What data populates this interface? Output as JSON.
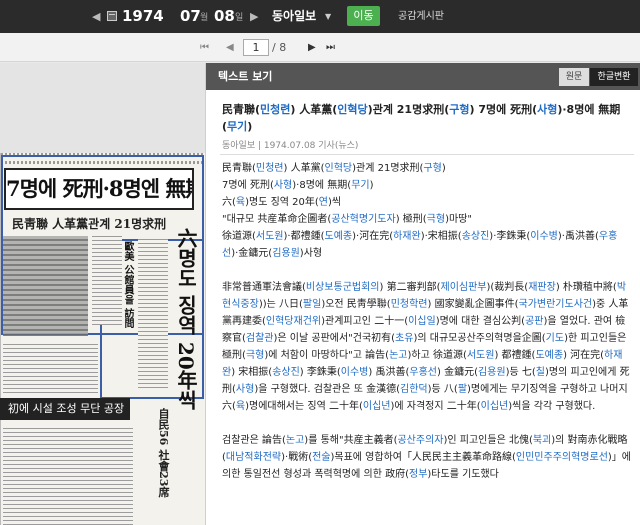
{
  "topbar": {
    "prev_label": "◀",
    "year": "1974",
    "month": "07",
    "month_unit": "월",
    "day": "08",
    "day_unit": "일",
    "next_label": "▶",
    "newspaper": "동아일보",
    "newspaper_arrow": "▼",
    "go_label": "이동",
    "board_label": "공감게시판"
  },
  "pager": {
    "first": "⏮",
    "prev": "◀",
    "current": "1",
    "total": "/ 8",
    "next": "▶",
    "last": "⏭"
  },
  "newspaper_image": {
    "headline": "7명에 死刑·8명엔 無期",
    "subhead": "民靑聯 人革黨관계 21명求刑",
    "vertical_head_1": "六명도 징역 20年씩",
    "vertical_head_2": "歐美 公館員을 訪問",
    "dark_bar": "初에 시설 조성 무단 공장",
    "bottom_right": "自民56 社會23席"
  },
  "panel": {
    "title": "텍스트 보기",
    "tab_original": "원문",
    "tab_korean": "한글변환",
    "article_title_parts": [
      {
        "t": "民青聯(",
        "h": false
      },
      {
        "t": "민청련",
        "h": true
      },
      {
        "t": ") 人革黨(",
        "h": false
      },
      {
        "t": "인혁당",
        "h": true
      },
      {
        "t": ")관계 21명求刑(",
        "h": false
      },
      {
        "t": "구형",
        "h": true
      },
      {
        "t": ") 7명에 死刑(",
        "h": false
      },
      {
        "t": "사형",
        "h": true
      },
      {
        "t": ")·8명에 無期(",
        "h": false
      },
      {
        "t": "무기",
        "h": true
      },
      {
        "t": ")",
        "h": false
      }
    ],
    "byline": "동아일보 | 1974.07.08 기사(뉴스)",
    "paragraphs": [
      [
        {
          "t": "民青聯(",
          "h": false
        },
        {
          "t": "민청련",
          "h": true
        },
        {
          "t": ") 人革黨(",
          "h": false
        },
        {
          "t": "인혁당",
          "h": true
        },
        {
          "t": ")관계 21명求刑(",
          "h": false
        },
        {
          "t": "구형",
          "h": true
        },
        {
          "t": ")\n7명에 死刑(",
          "h": false
        },
        {
          "t": "사형",
          "h": true
        },
        {
          "t": ")·8명에 無期(",
          "h": false
        },
        {
          "t": "무기",
          "h": true
        },
        {
          "t": ")\n六(",
          "h": false
        },
        {
          "t": "육",
          "h": true
        },
        {
          "t": ")명도 징역 20年(",
          "h": false
        },
        {
          "t": "연",
          "h": true
        },
        {
          "t": ")씩\n\"대규모 共産革命企圖者(",
          "h": false
        },
        {
          "t": "공산혁명기도자",
          "h": true
        },
        {
          "t": ") 極刑(",
          "h": false
        },
        {
          "t": "극형",
          "h": true
        },
        {
          "t": ")마땅\"\n徐道源(",
          "h": false
        },
        {
          "t": "서도원",
          "h": true
        },
        {
          "t": ")·都禮鍾(",
          "h": false
        },
        {
          "t": "도예종",
          "h": true
        },
        {
          "t": ")·河在完(",
          "h": false
        },
        {
          "t": "하재완",
          "h": true
        },
        {
          "t": ")·宋相振(",
          "h": false
        },
        {
          "t": "송상진",
          "h": true
        },
        {
          "t": ")·李銖秉(",
          "h": false
        },
        {
          "t": "이수병",
          "h": true
        },
        {
          "t": ")·禹洪善(",
          "h": false
        },
        {
          "t": "우홍선",
          "h": true
        },
        {
          "t": ")·金鏞元(",
          "h": false
        },
        {
          "t": "김용원",
          "h": true
        },
        {
          "t": ")사형",
          "h": false
        }
      ],
      [
        {
          "t": "非常普通軍法會議(",
          "h": false
        },
        {
          "t": "비상보통군법회의",
          "h": true
        },
        {
          "t": ") 第二審判部(",
          "h": false
        },
        {
          "t": "제이심판부",
          "h": true
        },
        {
          "t": ")(裁判長(",
          "h": false
        },
        {
          "t": "재판장",
          "h": true
        },
        {
          "t": ") 朴瓚稙中將(",
          "h": false
        },
        {
          "t": "박현식중장",
          "h": true
        },
        {
          "t": "))는 八日(",
          "h": false
        },
        {
          "t": "팔일",
          "h": true
        },
        {
          "t": ")오전 民靑學聯(",
          "h": false
        },
        {
          "t": "민청학련",
          "h": true
        },
        {
          "t": ") 國家變亂企圖事件(",
          "h": false
        },
        {
          "t": "국가변란기도사건",
          "h": true
        },
        {
          "t": ")중 人革黨再建委(",
          "h": false
        },
        {
          "t": "인혁당재건위",
          "h": true
        },
        {
          "t": ")관계피고인 二十一(",
          "h": false
        },
        {
          "t": "이십일",
          "h": true
        },
        {
          "t": ")명에 대한 결심公判(",
          "h": false
        },
        {
          "t": "공판",
          "h": true
        },
        {
          "t": ")을 열었다. 관여 檢察官(",
          "h": false
        },
        {
          "t": "검찰관",
          "h": true
        },
        {
          "t": ")은 이날 공판에서\"건국初有(",
          "h": false
        },
        {
          "t": "초유",
          "h": true
        },
        {
          "t": ")의 대규모공산주의혁명을企圖(",
          "h": false
        },
        {
          "t": "기도",
          "h": true
        },
        {
          "t": ")한 피고인들은 極刑(",
          "h": false
        },
        {
          "t": "극형",
          "h": true
        },
        {
          "t": ")에 처함이 마땅하다\"고 論告(",
          "h": false
        },
        {
          "t": "논고",
          "h": true
        },
        {
          "t": ")하고 徐道源(",
          "h": false
        },
        {
          "t": "서도원",
          "h": true
        },
        {
          "t": ") 都禮鍾(",
          "h": false
        },
        {
          "t": "도예종",
          "h": true
        },
        {
          "t": ") 河在完(",
          "h": false
        },
        {
          "t": "하재완",
          "h": true
        },
        {
          "t": ") 宋相振(",
          "h": false
        },
        {
          "t": "송상진",
          "h": true
        },
        {
          "t": ") 李銖秉(",
          "h": false
        },
        {
          "t": "이수병",
          "h": true
        },
        {
          "t": ") 禹洪善(",
          "h": false
        },
        {
          "t": "우홍선",
          "h": true
        },
        {
          "t": ") 金鏞元(",
          "h": false
        },
        {
          "t": "김용원",
          "h": true
        },
        {
          "t": ")등 七(",
          "h": false
        },
        {
          "t": "칠",
          "h": true
        },
        {
          "t": ")명의 피고인에게 死刑(",
          "h": false
        },
        {
          "t": "사형",
          "h": true
        },
        {
          "t": ")을 구형했다. 검찰관은 또 金漢德(",
          "h": false
        },
        {
          "t": "김한덕",
          "h": true
        },
        {
          "t": ")등 八(",
          "h": false
        },
        {
          "t": "팔",
          "h": true
        },
        {
          "t": ")명에게는 무기징역을 구형하고 나머지六(",
          "h": false
        },
        {
          "t": "육",
          "h": true
        },
        {
          "t": ")명에대해서는 징역 二十年(",
          "h": false
        },
        {
          "t": "이십년",
          "h": true
        },
        {
          "t": ")에 자격정지 二十年(",
          "h": false
        },
        {
          "t": "이십년",
          "h": true
        },
        {
          "t": ")씩을 각각 구형했다.",
          "h": false
        }
      ],
      [
        {
          "t": "검찰관은 論告(",
          "h": false
        },
        {
          "t": "논고",
          "h": true
        },
        {
          "t": ")를 통해\"共産主義者(",
          "h": false
        },
        {
          "t": "공산주의자",
          "h": true
        },
        {
          "t": ")인 피고인들은 北傀(",
          "h": false
        },
        {
          "t": "북괴",
          "h": true
        },
        {
          "t": ")의 對南赤化戰略(",
          "h": false
        },
        {
          "t": "대남적화전략",
          "h": true
        },
        {
          "t": ")·戰術(",
          "h": false
        },
        {
          "t": "전술",
          "h": true
        },
        {
          "t": ")목표에 영합하여「人民民主主義革命路線(",
          "h": false
        },
        {
          "t": "인민민주주의혁명로선",
          "h": true
        },
        {
          "t": ")」에의한 통일전선 형성과 폭력혁명에 의한 政府(",
          "h": false
        },
        {
          "t": "정부",
          "h": true
        },
        {
          "t": ")타도를 기도했다",
          "h": false
        }
      ]
    ]
  }
}
